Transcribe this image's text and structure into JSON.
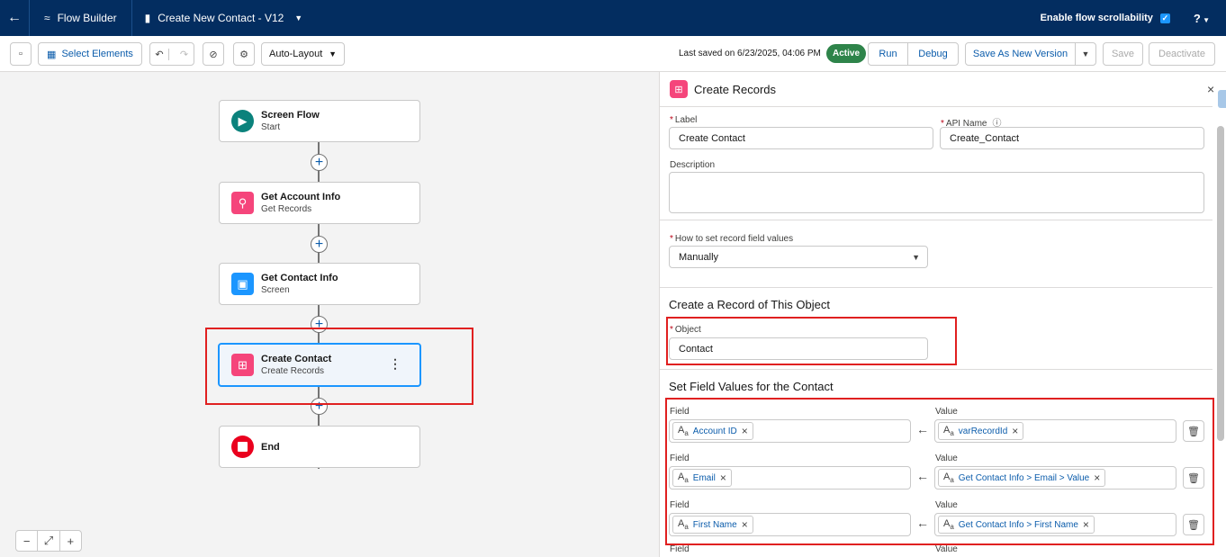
{
  "topbar": {
    "app_name": "Flow Builder",
    "flow_name": "Create New Contact - V12",
    "scrollability_label": "Enable flow scrollability",
    "help": "?"
  },
  "toolbar": {
    "select_elements": "Select Elements",
    "layout": "Auto-Layout",
    "last_saved": "Last saved on 6/23/2025, 04:06 PM",
    "status": "Active",
    "run": "Run",
    "debug": "Debug",
    "save_as_new": "Save As New Version",
    "save": "Save",
    "deactivate": "Deactivate"
  },
  "nodes": [
    {
      "title": "Screen Flow",
      "subtitle": "Start"
    },
    {
      "title": "Get Account Info",
      "subtitle": "Get Records"
    },
    {
      "title": "Get Contact Info",
      "subtitle": "Screen"
    },
    {
      "title": "Create Contact",
      "subtitle": "Create Records"
    },
    {
      "title": "End",
      "subtitle": ""
    }
  ],
  "panel": {
    "title": "Create Records",
    "label_label": "Label",
    "label_value": "Create Contact",
    "api_label": "API Name",
    "api_value": "Create_Contact",
    "description_label": "Description",
    "howto_label": "How to set record field values",
    "howto_value": "Manually",
    "section_create": "Create a Record of This Object",
    "object_label": "Object",
    "object_value": "Contact",
    "section_fields": "Set Field Values for the Contact",
    "field_label": "Field",
    "value_label": "Value",
    "rows": [
      {
        "field": "Account ID",
        "value": "varRecordId"
      },
      {
        "field": "Email",
        "value": "Get Contact Info > Email > Value"
      },
      {
        "field": "First Name",
        "value": "Get Contact Info > First Name"
      }
    ]
  },
  "colors": {
    "topbar": "#032d60",
    "active": "#2e844a",
    "highlight": "#e02020"
  }
}
